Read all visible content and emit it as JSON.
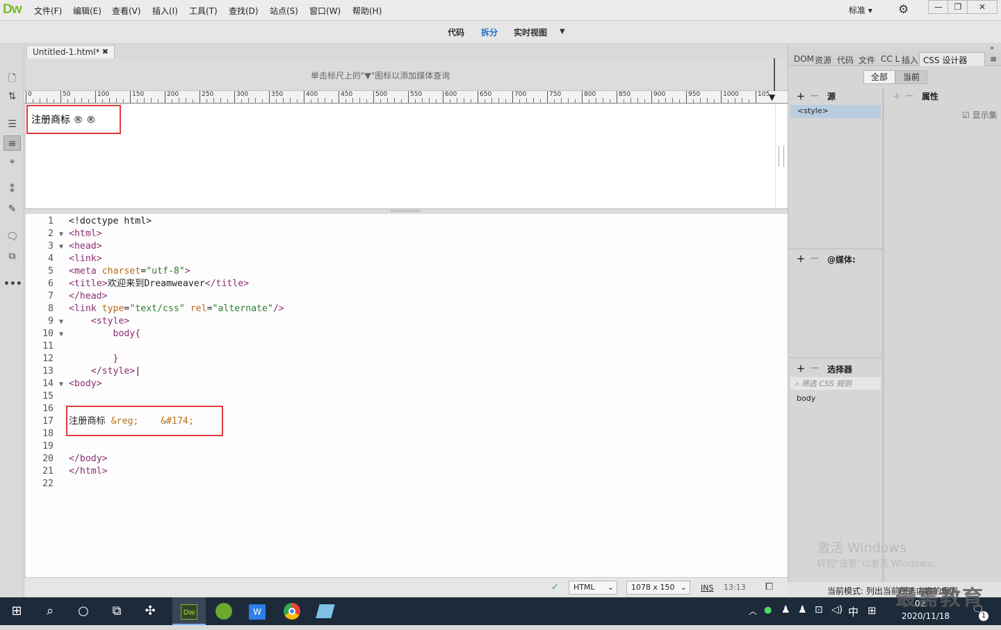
{
  "app": {
    "logo": "Dw"
  },
  "menu": [
    "文件(F)",
    "编辑(E)",
    "查看(V)",
    "插入(I)",
    "工具(T)",
    "查找(D)",
    "站点(S)",
    "窗口(W)",
    "帮助(H)"
  ],
  "workspace": "标准",
  "window_controls": [
    "—",
    "❐",
    "✕"
  ],
  "view_buttons": {
    "code": "代码",
    "split": "拆分",
    "live": "实时视图"
  },
  "document": {
    "tab_title": "Untitled-1.html*",
    "media_query_hint": "单击标尺上的\"▼\"图标以添加媒体查询",
    "ruler_ticks": [
      "0",
      "50",
      "100",
      "150",
      "200",
      "250",
      "300",
      "350",
      "400",
      "450",
      "500",
      "550",
      "600",
      "650",
      "700",
      "750",
      "800",
      "850",
      "900",
      "950",
      "1000",
      "105"
    ],
    "live_text": "注册商标 ® ®"
  },
  "code_lines": [
    {
      "n": "1",
      "fold": "",
      "html": "<span class=\"tx\">&lt;!doctype html&gt;</span>"
    },
    {
      "n": "2",
      "fold": "▼",
      "html": "<span class=\"tg\">&lt;html&gt;</span>"
    },
    {
      "n": "3",
      "fold": "▼",
      "html": "<span class=\"tg\">&lt;head&gt;</span>"
    },
    {
      "n": "4",
      "fold": "",
      "html": "<span class=\"tg\">&lt;link&gt;</span>"
    },
    {
      "n": "5",
      "fold": "",
      "html": "<span class=\"tg\">&lt;meta</span> <span class=\"at\">charset</span><span class=\"tx\">=</span><span class=\"vl\">\"utf-8\"</span><span class=\"tg\">&gt;</span>"
    },
    {
      "n": "6",
      "fold": "",
      "html": "<span class=\"tg\">&lt;title&gt;</span><span class=\"tx\">欢迎来到Dreamweaver</span><span class=\"tg\">&lt;/title&gt;</span>"
    },
    {
      "n": "7",
      "fold": "",
      "html": "<span class=\"tg\">&lt;/head&gt;</span>"
    },
    {
      "n": "8",
      "fold": "",
      "html": "<span class=\"tg\">&lt;link</span> <span class=\"at\">type</span><span class=\"tx\">=</span><span class=\"vl\">\"text/css\"</span> <span class=\"at\">rel</span><span class=\"tx\">=</span><span class=\"vl\">\"alternate\"</span><span class=\"tg\">/&gt;</span>"
    },
    {
      "n": "9",
      "fold": "▼",
      "html": "    <span class=\"tg\">&lt;style&gt;</span>"
    },
    {
      "n": "10",
      "fold": "▼",
      "html": "        <span class=\"tg\">body{</span>"
    },
    {
      "n": "11",
      "fold": "",
      "html": ""
    },
    {
      "n": "12",
      "fold": "",
      "html": "        <span class=\"tg\">}</span>"
    },
    {
      "n": "13",
      "fold": "",
      "html": "    <span class=\"tg\">&lt;/style&gt;</span><span class=\"tx\">|</span>"
    },
    {
      "n": "14",
      "fold": "▼",
      "html": "<span class=\"tg\">&lt;body&gt;</span>"
    },
    {
      "n": "15",
      "fold": "",
      "html": ""
    },
    {
      "n": "16",
      "fold": "",
      "html": ""
    },
    {
      "n": "17",
      "fold": "",
      "html": "<span class=\"tx\">注册商标 </span><span class=\"en\">&amp;reg;</span><span class=\"tx\">    </span><span class=\"en\">&amp;#174;</span>"
    },
    {
      "n": "18",
      "fold": "",
      "html": ""
    },
    {
      "n": "19",
      "fold": "",
      "html": ""
    },
    {
      "n": "20",
      "fold": "",
      "html": "<span class=\"tg\">&lt;/body&gt;</span>"
    },
    {
      "n": "21",
      "fold": "",
      "html": "<span class=\"tg\">&lt;/html&gt;</span>"
    },
    {
      "n": "22",
      "fold": "",
      "html": ""
    }
  ],
  "status": {
    "language": "HTML",
    "size": "1078 x 150",
    "mode": "INS",
    "position": "13:13"
  },
  "panel": {
    "tabs": [
      "DOM",
      "资源",
      "代码",
      "文件",
      "CC L",
      "插入",
      "CSS 设计器"
    ],
    "all": "全部",
    "current": "当前",
    "sources_title": "源",
    "source_item": "<style>",
    "properties_title": "属性",
    "show_set": "显示集",
    "media_title": "@媒体:",
    "selectors_title": "选择器",
    "selector_filter": "筛选 CSS 规则",
    "selector_item": "body",
    "footer": "当前模式: 列出当前所选内容的规则"
  },
  "watermark": {
    "line1": "激活 Windows",
    "line2": "转到\"设置\"以激活 Windows。",
    "brand": "最需教育"
  },
  "taskbar": {
    "ime": "中",
    "date": "2020/11/18",
    "time": "02",
    "badge": "1"
  }
}
